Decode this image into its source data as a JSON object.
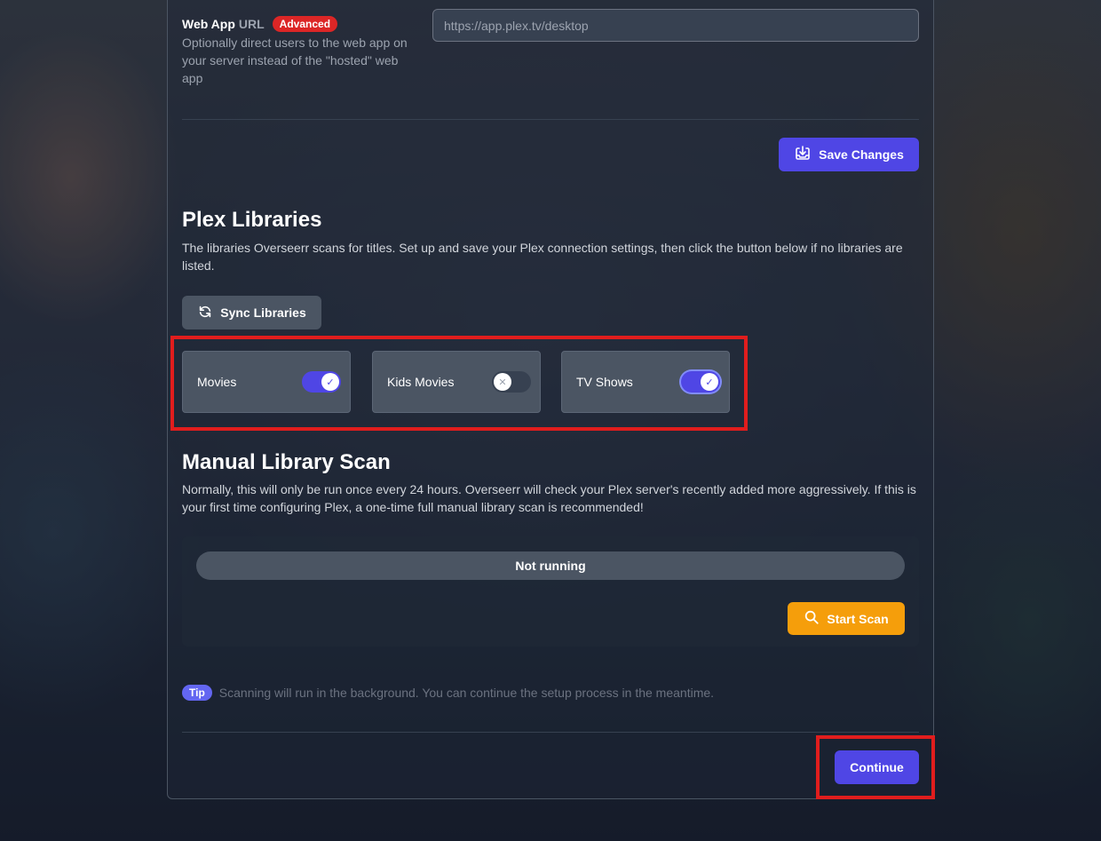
{
  "web_app": {
    "label": "Web App",
    "label_url": "URL",
    "badge": "Advanced",
    "hint": "Optionally direct users to the web app on your server instead of the \"hosted\" web app",
    "placeholder": "https://app.plex.tv/desktop",
    "value": ""
  },
  "save_button": {
    "label": "Save Changes",
    "icon": "download-tray-icon"
  },
  "plex_libraries": {
    "title": "Plex Libraries",
    "description": "The libraries Overseerr scans for titles. Set up and save your Plex connection settings, then click the button below if no libraries are listed.",
    "sync_button": {
      "label": "Sync Libraries",
      "icon": "refresh-icon"
    },
    "libraries": [
      {
        "name": "Movies",
        "enabled": true
      },
      {
        "name": "Kids Movies",
        "enabled": false
      },
      {
        "name": "TV Shows",
        "enabled": true
      }
    ]
  },
  "manual_scan": {
    "title": "Manual Library Scan",
    "description": "Normally, this will only be run once every 24 hours. Overseerr will check your Plex server's recently added more aggressively. If this is your first time configuring Plex, a one-time full manual library scan is recommended!",
    "status": "Not running",
    "start_button": {
      "label": "Start Scan",
      "icon": "search-icon"
    }
  },
  "tip": {
    "badge": "Tip",
    "text": "Scanning will run in the background. You can continue the setup process in the meantime."
  },
  "continue_button": {
    "label": "Continue"
  },
  "colors": {
    "accent": "#4f46e5",
    "danger": "#dc2626",
    "warning": "#f59e0b",
    "highlight_box": "#e11d1d"
  }
}
